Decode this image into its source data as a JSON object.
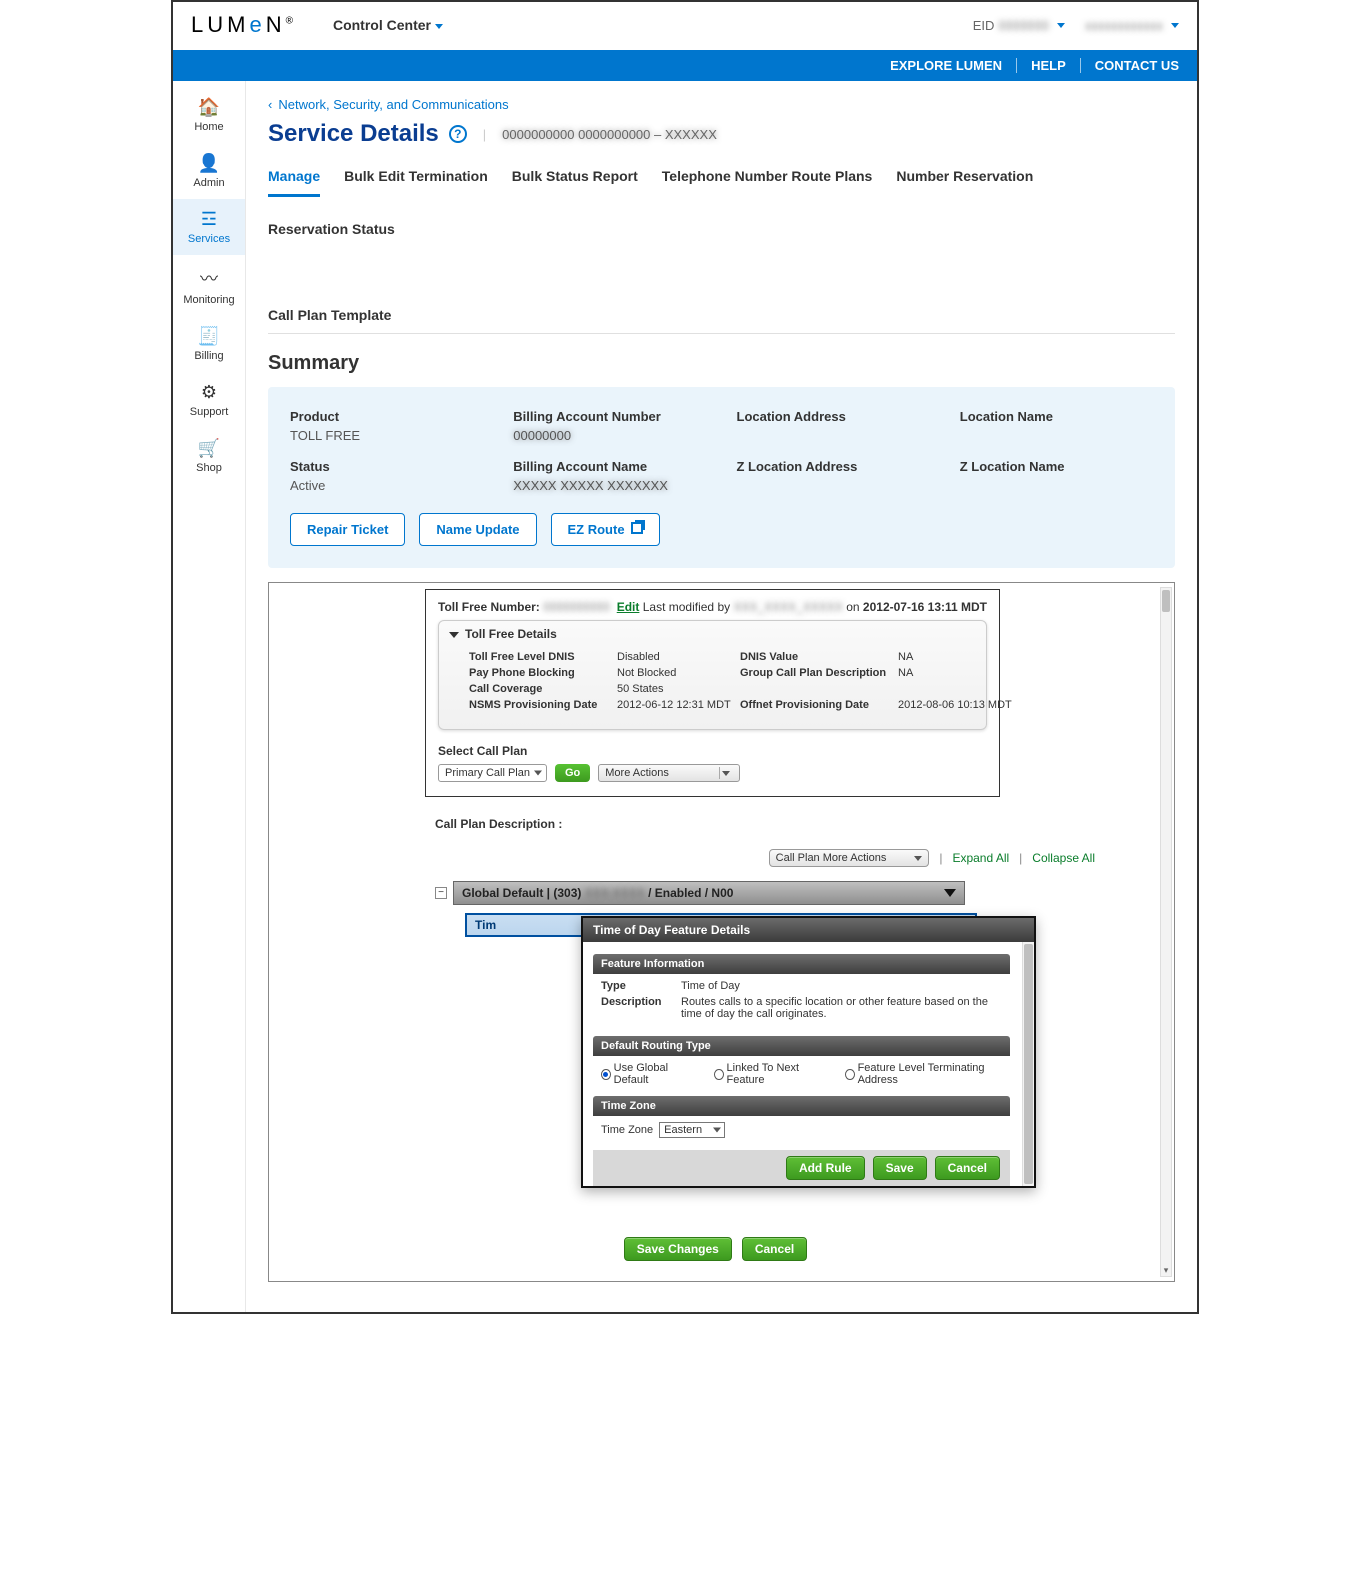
{
  "header": {
    "logo_text": "LUMeN",
    "control_center": "Control Center",
    "eid_label": "EID",
    "eid_value": "0000000",
    "username": "xxxxxxxxxxxx"
  },
  "bluebar": {
    "explore": "EXPLORE LUMEN",
    "help": "HELP",
    "contact": "CONTACT US"
  },
  "sidenav": [
    {
      "label": "Home",
      "icon": "🏠"
    },
    {
      "label": "Admin",
      "icon": "👤"
    },
    {
      "label": "Services",
      "icon": "☲",
      "active": true
    },
    {
      "label": "Monitoring",
      "icon": "〰"
    },
    {
      "label": "Billing",
      "icon": "🧾"
    },
    {
      "label": "Support",
      "icon": "⚙"
    },
    {
      "label": "Shop",
      "icon": "🛒"
    }
  ],
  "breadcrumb": "Network, Security, and Communications",
  "page_title": "Service Details",
  "title_meta": "0000000000   0000000000 – XXXXXX",
  "tabs": [
    "Manage",
    "Bulk Edit Termination",
    "Bulk Status Report",
    "Telephone Number Route Plans",
    "Number Reservation",
    "Reservation Status"
  ],
  "tabs_row2": [
    "Call Plan Template"
  ],
  "active_tab": "Manage",
  "summary_title": "Summary",
  "summary": {
    "cells": [
      {
        "lbl": "Product",
        "val": "TOLL FREE"
      },
      {
        "lbl": "Billing Account Number",
        "val": "00000000",
        "blur": true
      },
      {
        "lbl": "Location Address",
        "val": ""
      },
      {
        "lbl": "Location Name",
        "val": ""
      },
      {
        "lbl": "Status",
        "val": "Active"
      },
      {
        "lbl": "Billing Account Name",
        "val": "XXXXX XXXXX XXXXXXX",
        "blur": true
      },
      {
        "lbl": "Z Location Address",
        "val": ""
      },
      {
        "lbl": "Z Location Name",
        "val": ""
      }
    ],
    "actions": {
      "repair": "Repair Ticket",
      "name_update": "Name Update",
      "ez_route": "EZ Route"
    }
  },
  "legacy": {
    "tf_label": "Toll Free Number:",
    "tf_number": "0000000000",
    "edit": "Edit",
    "last_mod_prefix": "Last modified by",
    "last_mod_user": "XXX_XXXX_XXXXX",
    "last_mod_on": "on",
    "last_mod_date": "2012-07-16 13:11 MDT",
    "details_title": "Toll Free Details",
    "details": [
      {
        "k": "Toll Free Level DNIS",
        "v": "Disabled"
      },
      {
        "k": "DNIS Value",
        "v": "NA"
      },
      {
        "k": "Pay Phone Blocking",
        "v": "Not Blocked"
      },
      {
        "k": "Group Call Plan Description",
        "v": "NA"
      },
      {
        "k": "Call Coverage",
        "v": "50 States"
      },
      {
        "k": "",
        "v": ""
      },
      {
        "k": "NSMS Provisioning Date",
        "v": "2012-06-12 12:31 MDT"
      },
      {
        "k": "Offnet Provisioning Date",
        "v": "2012-08-06 10:13 MDT"
      }
    ],
    "select_plan": "Select Call Plan",
    "plan_selected": "Primary Call Plan",
    "go": "Go",
    "more_actions": "More Actions",
    "plan_desc_label": "Call Plan Description :",
    "cp_more": "Call Plan More Actions",
    "expand_all": "Expand All",
    "collapse_all": "Collapse All",
    "node_text": "Global Default | (303) XXX-XXXX / Enabled / N00",
    "child_text": "Tim",
    "save_changes": "Save Changes",
    "cancel": "Cancel"
  },
  "modal": {
    "title": "Time of Day Feature Details",
    "feature_info": "Feature Information",
    "rows": [
      {
        "k": "Type",
        "v": "Time of Day"
      },
      {
        "k": "Description",
        "v": "Routes calls to a specific location or other feature based on the time of day the call originates."
      }
    ],
    "routing_label": "Default Routing Type",
    "radios": [
      "Use Global Default",
      "Linked To Next Feature",
      "Feature Level Terminating Address"
    ],
    "radio_selected": 0,
    "tz_section": "Time Zone",
    "tz_label": "Time Zone",
    "tz_value": "Eastern",
    "add_rule": "Add Rule",
    "save": "Save",
    "cancel": "Cancel"
  }
}
